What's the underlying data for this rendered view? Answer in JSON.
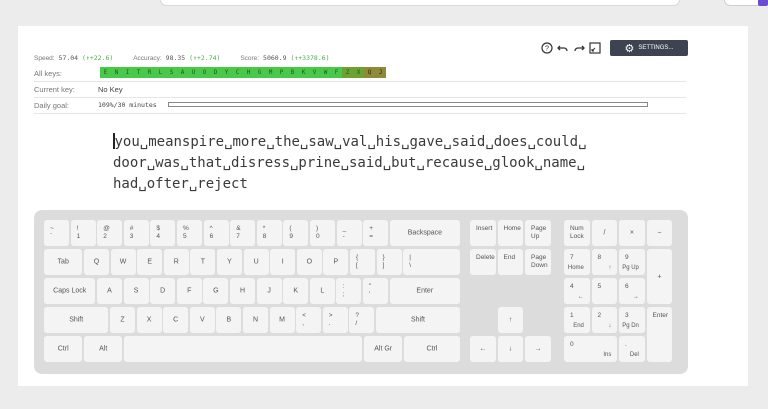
{
  "stats": {
    "speed_label": "Speed:",
    "speed_value": "57.04",
    "speed_delta": "(↑+22.6)",
    "accuracy_label": "Accuracy:",
    "accuracy_value": "98.35",
    "accuracy_delta": "(↑+2.74)",
    "score_label": "Score:",
    "score_value": "5060.9",
    "score_delta": "(↑+3378.6)"
  },
  "all_keys_label": "All keys:",
  "all_keys": [
    "E",
    "N",
    "I",
    "T",
    "R",
    "L",
    "S",
    "A",
    "U",
    "O",
    "D",
    "Y",
    "C",
    "H",
    "G",
    "M",
    "P",
    "B",
    "K",
    "V",
    "W",
    "F",
    "Z",
    "X",
    "Q",
    "J"
  ],
  "current_key_label": "Current key:",
  "current_key_value": "No Key",
  "daily_goal_label": "Daily goal:",
  "daily_goal_value": "109%/30 minutes",
  "daily_goal_progress": 1.0,
  "settings_label": "SETTINGS...",
  "icons": [
    "help-icon",
    "undo-icon",
    "redo-icon",
    "fullscreen-icon",
    "gear-icon"
  ],
  "text_lines": [
    "you␣meanspire␣more␣the␣saw␣val␣his␣gave␣said␣does␣could␣",
    "door␣was␣that␣disress␣prine␣said␣but␣recause␣glook␣name␣",
    "had␣ofter␣reject"
  ],
  "keyboard": {
    "row1": [
      [
        "~",
        "`"
      ],
      [
        "!",
        "1"
      ],
      [
        "@",
        "2"
      ],
      [
        "#",
        "3"
      ],
      [
        "$",
        "4"
      ],
      [
        "%",
        "5"
      ],
      [
        "^",
        "6"
      ],
      [
        "&",
        "7"
      ],
      [
        "*",
        "8"
      ],
      [
        "(",
        "9"
      ],
      [
        ")",
        "0"
      ],
      [
        "_",
        "-"
      ],
      [
        "+",
        "="
      ]
    ],
    "backspace": "Backspace",
    "tab": "Tab",
    "row2": [
      "Q",
      "W",
      "E",
      "R",
      "T",
      "Y",
      "U",
      "I",
      "O",
      "P"
    ],
    "row2_sym": [
      [
        "{",
        "["
      ],
      [
        "}",
        "]"
      ],
      [
        "|",
        "\\"
      ]
    ],
    "caps": "Caps Lock",
    "row3": [
      "A",
      "S",
      "D",
      "F",
      "G",
      "H",
      "J",
      "K",
      "L"
    ],
    "row3_sym": [
      [
        ":",
        ";"
      ],
      [
        "\"",
        "'"
      ]
    ],
    "enter": "Enter",
    "shift": "Shift",
    "row4": [
      "Z",
      "X",
      "C",
      "V",
      "B",
      "N",
      "M"
    ],
    "row4_sym": [
      [
        "<",
        ","
      ],
      [
        ">",
        "."
      ],
      [
        "?",
        "/"
      ]
    ],
    "ctrl": "Ctrl",
    "alt": "Alt",
    "altgr": "Alt Gr",
    "nav_top": [
      "Insert",
      "Home",
      "Page Up"
    ],
    "nav_bottom": [
      "Delete",
      "End",
      "Page Down"
    ],
    "arrow_up": "↑",
    "arrow_left": "←",
    "arrow_down": "↓",
    "arrow_right": "→",
    "numlock": "Num Lock",
    "num_div": "/",
    "num_mul": "×",
    "num_minus": "−",
    "num_plus": "+",
    "num_enter": "Enter",
    "num7": [
      "7",
      "Home"
    ],
    "num8": [
      "8",
      "↑"
    ],
    "num9": [
      "9",
      "Pg Up"
    ],
    "num4": [
      "4",
      "←"
    ],
    "num5": [
      "5",
      ""
    ],
    "num6": [
      "6",
      "→"
    ],
    "num1": [
      "1",
      "End"
    ],
    "num2": [
      "2",
      "↓"
    ],
    "num3": [
      "3",
      "Pg Dn"
    ],
    "num0": [
      "0",
      "Ins"
    ],
    "numdot": [
      ".",
      "Del"
    ]
  }
}
